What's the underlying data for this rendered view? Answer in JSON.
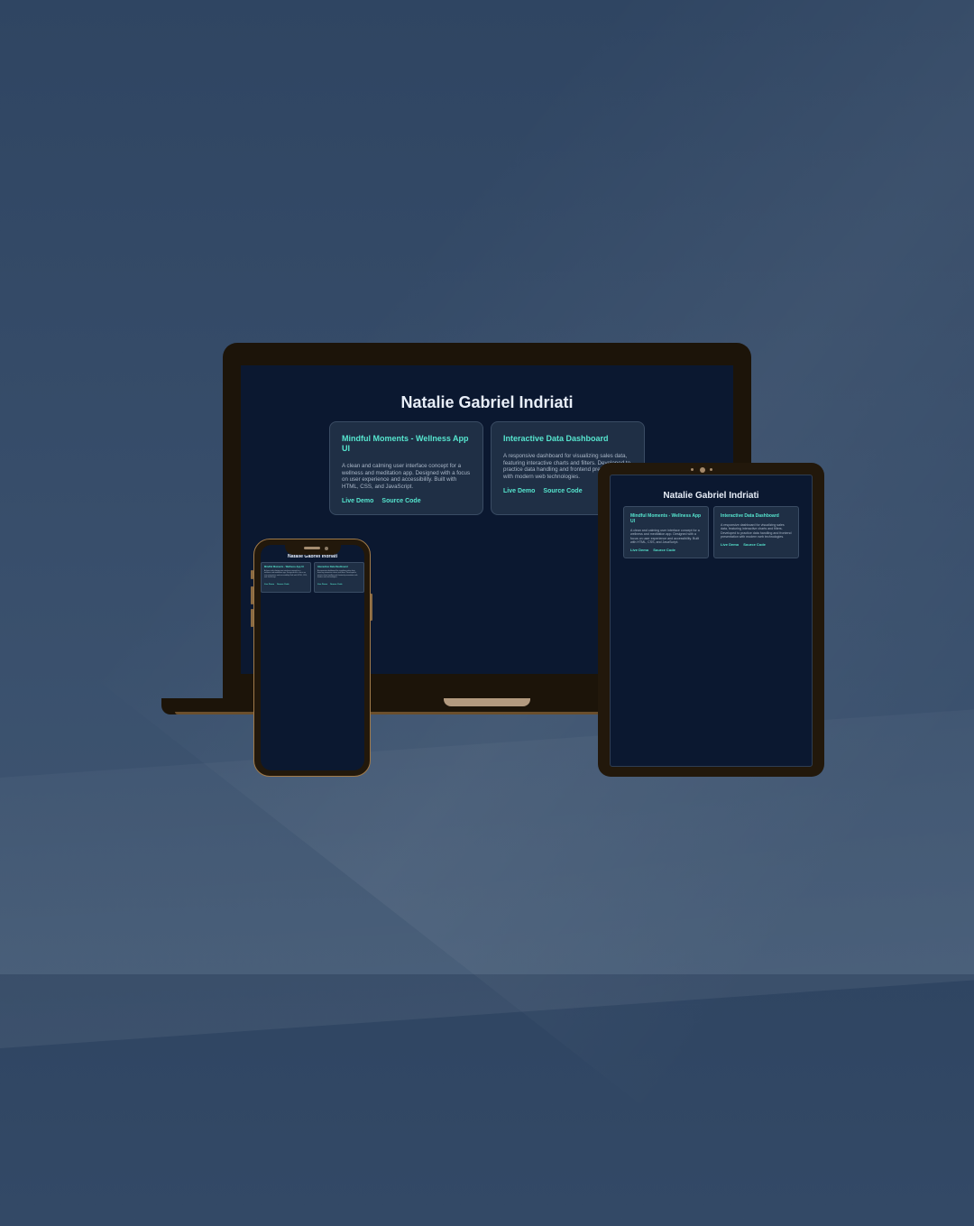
{
  "portfolio": {
    "name": "Natalie Gabriel Indriati",
    "projects": [
      {
        "title": "Mindful Moments - Wellness App UI",
        "description": "A clean and calming user interface concept for a wellness and meditation app. Designed with a focus on user experience and accessibility. Built with HTML, CSS, and JavaScript.",
        "links": [
          "Live Demo",
          "Source Code"
        ]
      },
      {
        "title": "Interactive Data Dashboard",
        "description": "A responsive dashboard for visualizing sales data, featuring interactive charts and filters. Developed to practice data handling and frontend presentation with modern web technologies.",
        "links": [
          "Live Demo",
          "Source Code"
        ]
      }
    ]
  },
  "devices": [
    "laptop",
    "tablet",
    "phone"
  ],
  "colors": {
    "background": "#34496a",
    "screen": "#0b1830",
    "card": "#1f2f45",
    "accent": "#56e6cf",
    "bezel": "#1c1409"
  }
}
